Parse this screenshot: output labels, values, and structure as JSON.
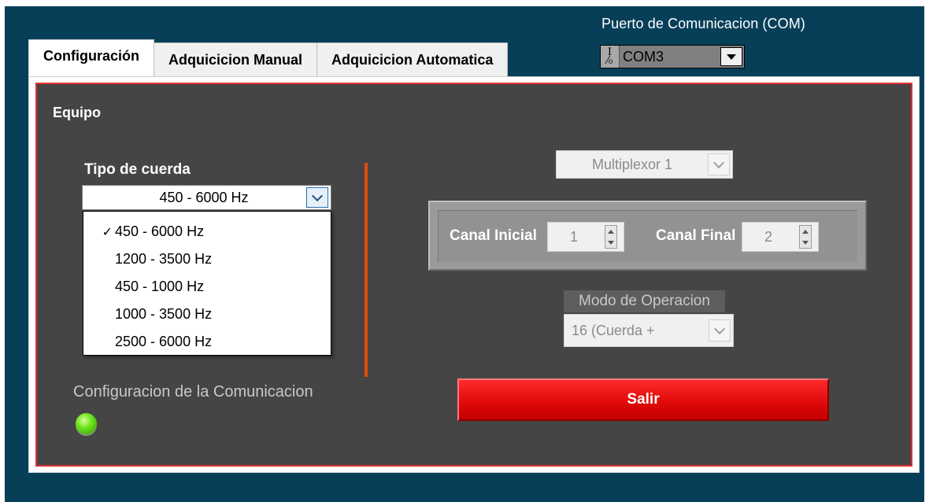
{
  "com_port": {
    "label": "Puerto de Comunicacion (COM)",
    "io_glyph": "I/O",
    "value": "COM3"
  },
  "tabs": [
    {
      "label": "Configuración",
      "active": true
    },
    {
      "label": "Adquicicion Manual",
      "active": false
    },
    {
      "label": "Adquicicion Automatica",
      "active": false
    }
  ],
  "equipo": {
    "title": "Equipo"
  },
  "tipo_cuerda": {
    "label": "Tipo de cuerda",
    "selected": "450 - 6000 Hz",
    "options": [
      "450 - 6000 Hz",
      "1200 - 3500 Hz",
      "450 - 1000 Hz",
      "1000 - 3500 Hz",
      "2500 - 6000 Hz"
    ],
    "checkmark": "✓"
  },
  "comunicacion": {
    "label": "Configuracion de la Comunicacion",
    "led_status": "on"
  },
  "multiplexor": {
    "value": "Multiplexor 1"
  },
  "canal_inicial": {
    "label": "Canal Inicial",
    "value": "1"
  },
  "canal_final": {
    "label": "Canal Final",
    "value": "2"
  },
  "modo": {
    "label": "Modo de Operacion",
    "value": "16 (Cuerda +"
  },
  "salir": {
    "label": "Salir"
  },
  "colors": {
    "window_bg": "#073f59",
    "panel_bg": "#454545",
    "panel_border": "#e03131",
    "divider": "#e24c0c",
    "exit_button": "#e20a0a",
    "led": "#6fe51a"
  }
}
